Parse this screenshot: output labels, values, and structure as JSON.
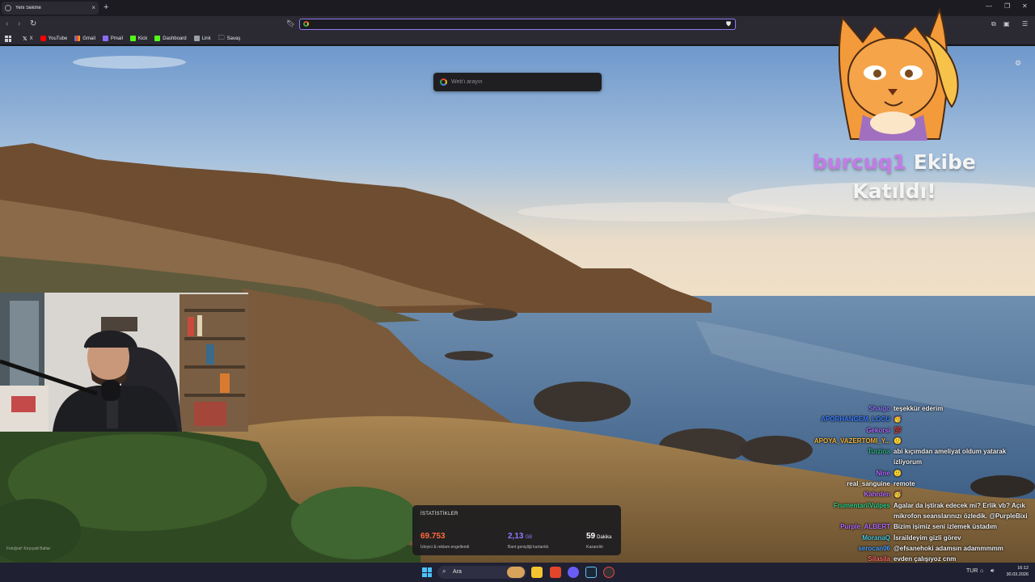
{
  "browser": {
    "tab_title": "Yeni Sekme",
    "url_value": "",
    "bookmarks": [
      {
        "label": "X",
        "icon": "x-logo-icon",
        "color": "#ffffff"
      },
      {
        "label": "YouTube",
        "icon": "youtube-icon",
        "color": "#ff0000"
      },
      {
        "label": "Gmail",
        "icon": "gmail-icon",
        "color": "#ea4335"
      },
      {
        "label": "Pmail",
        "icon": "proton-mail-icon",
        "color": "#8b6cf6"
      },
      {
        "label": "Kick",
        "icon": "kick-icon",
        "color": "#53fc18"
      },
      {
        "label": "Dashboard",
        "icon": "kick-icon",
        "color": "#53fc18"
      },
      {
        "label": "Link",
        "icon": "grid-icon",
        "color": "#9aa0a6"
      },
      {
        "label": "Savaş",
        "icon": "folder-icon",
        "color": "#cfcfd6"
      }
    ]
  },
  "newtab": {
    "search_placeholder": "Web'i arayın"
  },
  "alert": {
    "username": "burcuq1",
    "message": "Ekibe Katıldı!"
  },
  "chat": [
    {
      "user": "Shaigo",
      "color": "#8c7bff",
      "message": "teşekkür ederim"
    },
    {
      "user": "APORHANGEM_LOCU",
      "color": "#3b7cff",
      "message": "🥳"
    },
    {
      "user": "Gekorsi",
      "color": "#b26bff",
      "message": "💯"
    },
    {
      "user": "APOYA_VAZERTOMI_Y...",
      "color": "#f2b233",
      "message": "🙂"
    },
    {
      "user": "Turzina",
      "color": "#2ab27b",
      "message": "abi kıçımdan ameliyat oldum yatarak izliyorum"
    },
    {
      "user": "Nine",
      "color": "#b26bff",
      "message": "🙂"
    },
    {
      "user": "real_sanguine",
      "color": "#f2f2f2",
      "message": "remote"
    },
    {
      "user": "Kahrden",
      "color": "#b26bff",
      "message": "🥳"
    },
    {
      "user": "FrumentariiVulpes",
      "color": "#2fd18a",
      "message": "Agalar da iştirak edecek mi? Erlik vb? Açık mikrofon seanslarınızı özledik. @PurpleBixi"
    },
    {
      "user": "Purple_ALBERT",
      "color": "#b26bff",
      "message": "Bizim işimiz seni izlemek üstadım"
    },
    {
      "user": "MoranaQ",
      "color": "#46c8e0",
      "message": "İsraildeyim gizli görev"
    },
    {
      "user": "serocan06",
      "color": "#46a0ff",
      "message": "@efsanehoki adamsın adammmmm"
    },
    {
      "user": "Silasila",
      "color": "#ff6a6a",
      "message": "evden çalışıyoz cnm"
    }
  ],
  "stats": {
    "heading": "İSTATİSTİKLER",
    "items": [
      {
        "value": "69.753",
        "unit": "",
        "label": "İzleyici & reklam engellendi",
        "color": "#ff6a3d"
      },
      {
        "value": "2,13",
        "unit": "GB",
        "label": "Bant genişliği kurtarıldı",
        "color": "#8c7bff"
      },
      {
        "value": "59",
        "unit": "Dakika",
        "label": "Kazanıldı",
        "color": "#ffffff"
      }
    ]
  },
  "watermark": "Fotoğraf: Kıryıyatt Baltar",
  "taskbar": {
    "search_label": "Ara",
    "time": "16:12",
    "date": "30.03.2026",
    "tray_text": "TUR"
  }
}
